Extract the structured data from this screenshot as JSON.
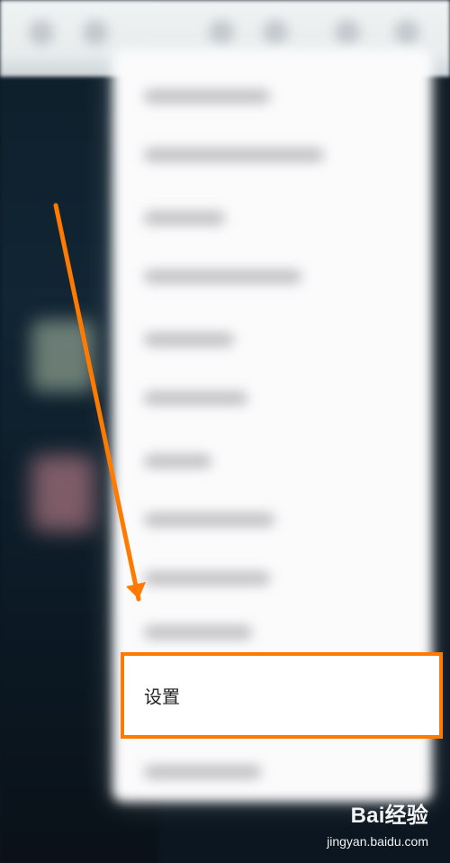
{
  "menu": {
    "settings_label": "设置"
  },
  "watermark": {
    "logo_text": "Bai经验",
    "url_text": "jingyan.baidu.com"
  },
  "colors": {
    "highlight": "#ff7a00",
    "arrow": "#ff7a00"
  },
  "icons": {
    "arrow": "arrow-icon"
  }
}
